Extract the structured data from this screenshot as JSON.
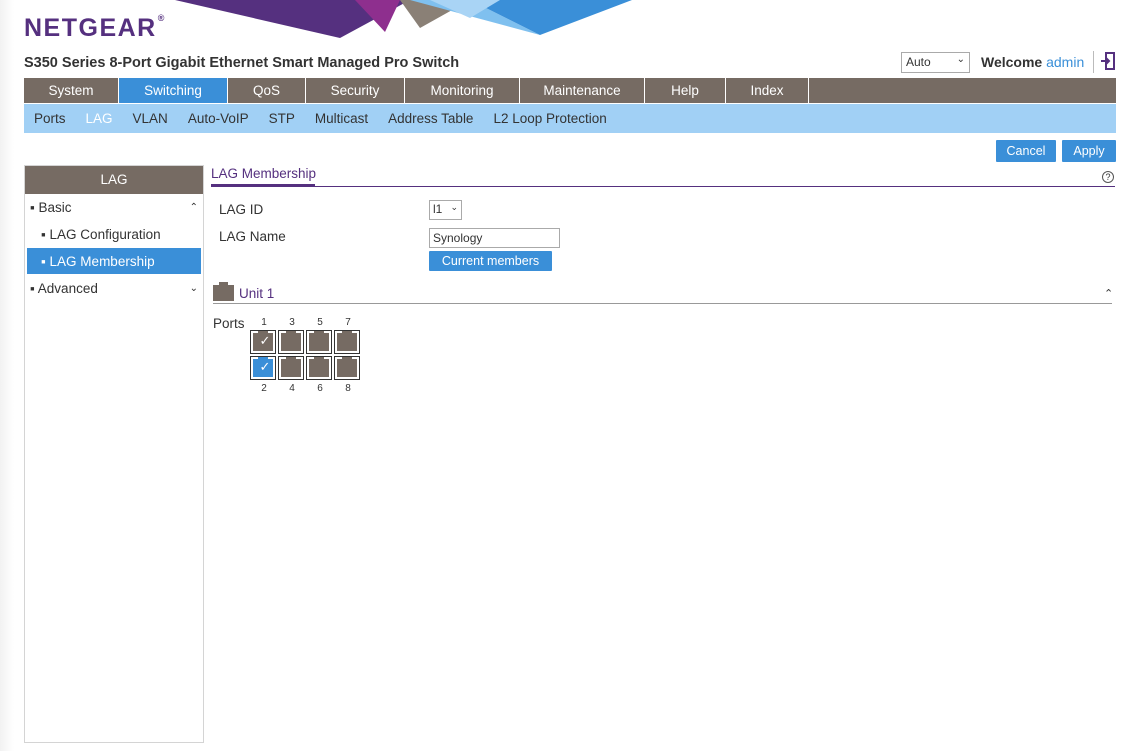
{
  "brand": {
    "name": "NETGEAR",
    "trademark": "®"
  },
  "product_title": "S350 Series 8-Port Gigabit Ethernet Smart Managed Pro Switch",
  "header": {
    "language_select": "Auto",
    "welcome_label": "Welcome",
    "username": "admin",
    "logout_icon": "logout-icon"
  },
  "main_nav": [
    {
      "label": "System",
      "active": false
    },
    {
      "label": "Switching",
      "active": true
    },
    {
      "label": "QoS",
      "active": false
    },
    {
      "label": "Security",
      "active": false
    },
    {
      "label": "Monitoring",
      "active": false
    },
    {
      "label": "Maintenance",
      "active": false
    },
    {
      "label": "Help",
      "active": false
    },
    {
      "label": "Index",
      "active": false
    }
  ],
  "sub_nav": [
    {
      "label": "Ports",
      "active": false
    },
    {
      "label": "LAG",
      "active": true
    },
    {
      "label": "VLAN",
      "active": false
    },
    {
      "label": "Auto-VoIP",
      "active": false
    },
    {
      "label": "STP",
      "active": false
    },
    {
      "label": "Multicast",
      "active": false
    },
    {
      "label": "Address Table",
      "active": false
    },
    {
      "label": "L2 Loop Protection",
      "active": false
    }
  ],
  "actions": {
    "cancel": "Cancel",
    "apply": "Apply"
  },
  "sidebar": {
    "title": "LAG",
    "basic": "Basic",
    "lag_configuration": "LAG Configuration",
    "lag_membership": "LAG Membership",
    "advanced": "Advanced"
  },
  "section": {
    "title": "LAG Membership",
    "help_icon": "help-icon"
  },
  "form": {
    "lag_id_label": "LAG ID",
    "lag_id_value": "l1",
    "lag_name_label": "LAG Name",
    "lag_name_value": "Synology",
    "current_members_button": "Current members"
  },
  "unit": {
    "title": "Unit 1",
    "ports_label": "Ports",
    "ports": [
      {
        "number": "1",
        "checked": true,
        "selected": false
      },
      {
        "number": "2",
        "checked": true,
        "selected": true
      },
      {
        "number": "3",
        "checked": false,
        "selected": false
      },
      {
        "number": "4",
        "checked": false,
        "selected": false
      },
      {
        "number": "5",
        "checked": false,
        "selected": false
      },
      {
        "number": "6",
        "checked": false,
        "selected": false
      },
      {
        "number": "7",
        "checked": false,
        "selected": false
      },
      {
        "number": "8",
        "checked": false,
        "selected": false
      }
    ]
  },
  "colors": {
    "brand_purple": "#55307f",
    "accent_blue": "#3a8fd8",
    "nav_brown": "#766b63",
    "subnav_blue": "#a1d0f5"
  }
}
